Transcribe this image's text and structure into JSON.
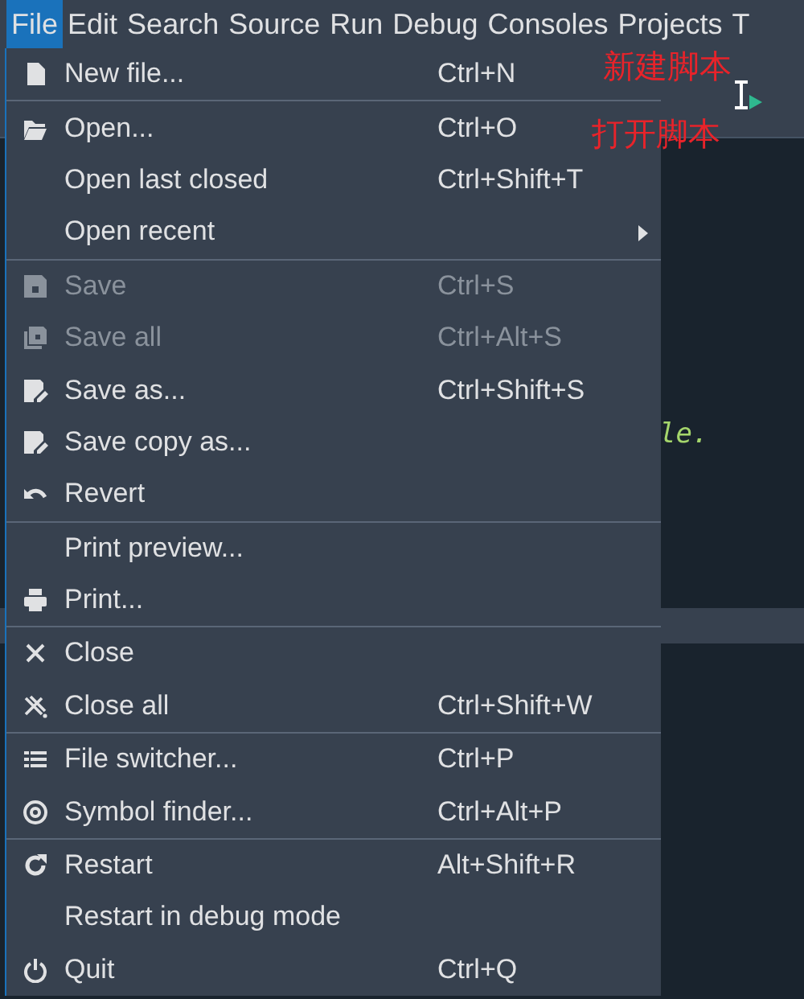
{
  "menubar": [
    {
      "label": "File",
      "selected": true
    },
    {
      "label": "Edit",
      "selected": false
    },
    {
      "label": "Search",
      "selected": false
    },
    {
      "label": "Source",
      "selected": false
    },
    {
      "label": "Run",
      "selected": false
    },
    {
      "label": "Debug",
      "selected": false
    },
    {
      "label": "Consoles",
      "selected": false
    },
    {
      "label": "Projects",
      "selected": false
    },
    {
      "label": "T",
      "selected": false
    }
  ],
  "menu": {
    "groups": [
      [
        {
          "label": "New file...",
          "shortcut": "Ctrl+N",
          "disabled": false,
          "submenu": false
        }
      ],
      [
        {
          "label": "Open...",
          "shortcut": "Ctrl+O",
          "disabled": false,
          "submenu": false
        },
        {
          "label": "Open last closed",
          "shortcut": "Ctrl+Shift+T",
          "disabled": false,
          "submenu": false
        },
        {
          "label": "Open recent",
          "disabled": false,
          "submenu": true
        }
      ],
      [
        {
          "label": "Save",
          "shortcut": "Ctrl+S",
          "disabled": true,
          "submenu": false
        },
        {
          "label": "Save all",
          "shortcut": "Ctrl+Alt+S",
          "disabled": true,
          "submenu": false
        },
        {
          "label": "Save as...",
          "shortcut": "Ctrl+Shift+S",
          "disabled": false,
          "submenu": false
        },
        {
          "label": "Save copy as...",
          "disabled": false,
          "submenu": false
        },
        {
          "label": "Revert",
          "disabled": false,
          "submenu": false
        }
      ],
      [
        {
          "label": "Print preview...",
          "disabled": false,
          "submenu": false
        },
        {
          "label": "Print...",
          "disabled": false,
          "submenu": false
        }
      ],
      [
        {
          "label": "Close",
          "disabled": false,
          "submenu": false
        },
        {
          "label": "Close all",
          "shortcut": "Ctrl+Shift+W",
          "disabled": false,
          "submenu": false
        }
      ],
      [
        {
          "label": "File switcher...",
          "shortcut": "Ctrl+P",
          "disabled": false,
          "submenu": false
        },
        {
          "label": "Symbol finder...",
          "shortcut": "Ctrl+Alt+P",
          "disabled": false,
          "submenu": false
        }
      ],
      [
        {
          "label": "Restart",
          "shortcut": "Alt+Shift+R",
          "disabled": false,
          "submenu": false
        },
        {
          "label": "Restart in debug mode",
          "disabled": false,
          "submenu": false
        },
        {
          "label": "Quit",
          "shortcut": "Ctrl+Q",
          "disabled": false,
          "submenu": false
        }
      ]
    ]
  },
  "annotations": [
    {
      "text": "新建脚本"
    },
    {
      "text": "打开脚本"
    }
  ],
  "editor": {
    "code_fragment": "le."
  }
}
